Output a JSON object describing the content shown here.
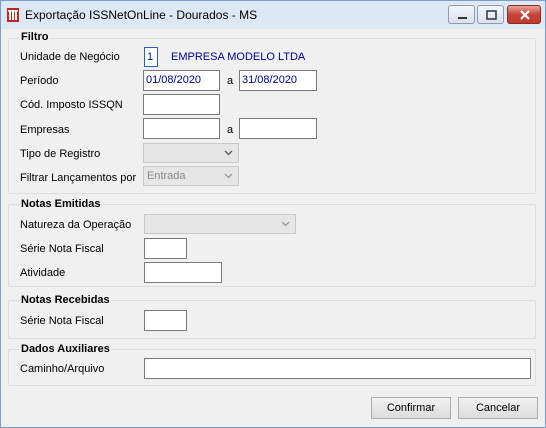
{
  "window": {
    "title": "Exportação ISSNetOnLine - Dourados - MS",
    "icon": "app-logo-icon"
  },
  "filtro": {
    "title": "Filtro",
    "unidade_label": "Unidade de Negócio",
    "unidade_code": "1",
    "unidade_name": "EMPRESA MODELO LTDA",
    "periodo_label": "Período",
    "periodo_from": "01/08/2020",
    "periodo_sep": "a",
    "periodo_to": "31/08/2020",
    "cod_imposto_label": "Cód. Imposto ISSQN",
    "cod_imposto_value": "",
    "empresas_label": "Empresas",
    "empresas_from": "",
    "empresas_sep": "a",
    "empresas_to": "",
    "tipo_registro_label": "Tipo de Registro",
    "tipo_registro_value": "",
    "filtrar_label": "Filtrar Lançamentos por",
    "filtrar_value": "Entrada"
  },
  "notas_emitidas": {
    "title": "Notas Emitidas",
    "natureza_label": "Natureza da Operação",
    "natureza_value": "",
    "serie_label": "Série Nota Fiscal",
    "serie_value": "",
    "atividade_label": "Atividade",
    "atividade_value": ""
  },
  "notas_recebidas": {
    "title": "Notas Recebidas",
    "serie_label": "Série Nota Fiscal",
    "serie_value": ""
  },
  "dados_auxiliares": {
    "title": "Dados Auxiliares",
    "caminho_label": "Caminho/Arquivo",
    "caminho_value": ""
  },
  "buttons": {
    "confirmar": "Confirmar",
    "cancelar": "Cancelar"
  },
  "colors": {
    "titlebar": "#dde8f5",
    "window_bg": "#f0f0f0",
    "link": "#000099",
    "close_button": "#c7443a"
  }
}
